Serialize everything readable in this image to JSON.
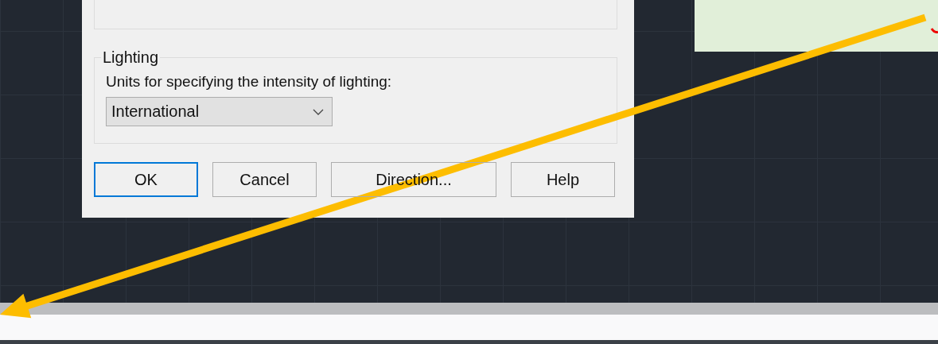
{
  "dialog": {
    "lighting": {
      "title": "Lighting",
      "label": "Units for specifying the intensity of lighting:",
      "dropdown": {
        "value": "International"
      }
    },
    "buttons": [
      {
        "label": "OK",
        "default": true
      },
      {
        "label": "Cancel",
        "default": false
      },
      {
        "label": "Direction...",
        "default": false
      },
      {
        "label": "Help",
        "default": false
      }
    ]
  }
}
